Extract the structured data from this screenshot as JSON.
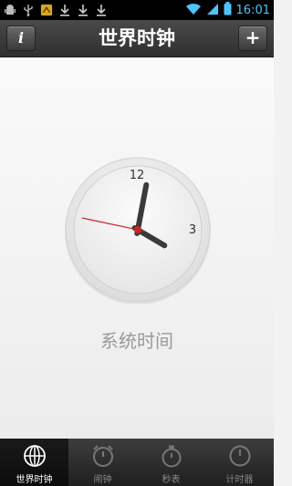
{
  "status_bar": {
    "time": "16:01",
    "icons": [
      "android-debug-icon",
      "usb-icon",
      "sim-toolkit-icon",
      "download-icon",
      "download-icon",
      "download-icon",
      "wifi-icon",
      "signal-icon",
      "battery-icon"
    ]
  },
  "title_bar": {
    "title": "世界时钟",
    "info_label": "i",
    "add_label": "+"
  },
  "clock": {
    "numerals": {
      "twelve": "12",
      "three": "3"
    },
    "time": {
      "hour": 4,
      "minute": 1,
      "second": 47
    },
    "caption": "系统时间"
  },
  "bottom_nav": {
    "items": [
      {
        "label": "世界时钟",
        "icon": "globe-icon",
        "active": true
      },
      {
        "label": "闹钟",
        "icon": "alarm-clock-icon",
        "active": false
      },
      {
        "label": "秒表",
        "icon": "stopwatch-icon",
        "active": false
      },
      {
        "label": "计时器",
        "icon": "timer-icon",
        "active": false
      }
    ]
  },
  "colors": {
    "accent_time": "#4fc3f7",
    "second_hand": "#c62828",
    "title_bar": "#3a3a3a"
  }
}
